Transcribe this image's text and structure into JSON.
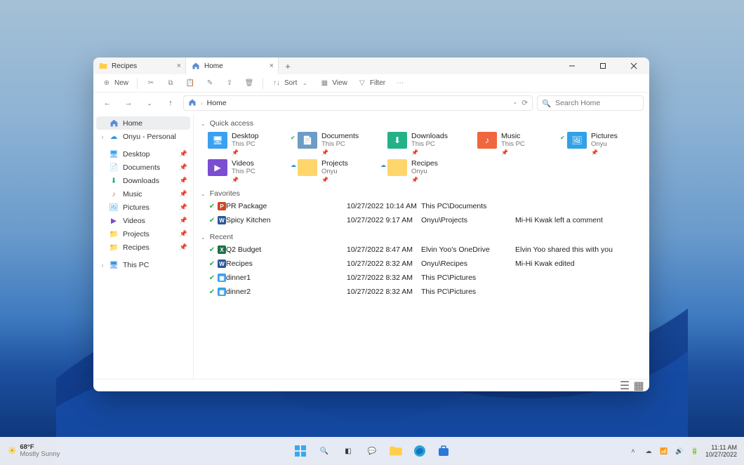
{
  "tabs": [
    {
      "label": "Recipes"
    },
    {
      "label": "Home"
    }
  ],
  "toolbar": {
    "new": "New",
    "sort": "Sort",
    "view": "View",
    "filter": "Filter"
  },
  "address": {
    "current": "Home"
  },
  "search": {
    "placeholder": "Search Home"
  },
  "sidebar": {
    "top": [
      {
        "label": "Home"
      },
      {
        "label": "Onyu - Personal"
      }
    ],
    "pinned": [
      {
        "label": "Desktop"
      },
      {
        "label": "Documents"
      },
      {
        "label": "Downloads"
      },
      {
        "label": "Music"
      },
      {
        "label": "Pictures"
      },
      {
        "label": "Videos"
      },
      {
        "label": "Projects"
      },
      {
        "label": "Recipes"
      }
    ],
    "bottom": [
      {
        "label": "This PC"
      }
    ]
  },
  "groups": {
    "quick_access": "Quick access",
    "favorites": "Favorites",
    "recent": "Recent"
  },
  "quick_access": [
    {
      "name": "Desktop",
      "loc": "This PC",
      "color": "#3aa0f0",
      "icon": "desktop"
    },
    {
      "name": "Documents",
      "loc": "This PC",
      "color": "#6d9cc4",
      "icon": "doc",
      "badge": true
    },
    {
      "name": "Downloads",
      "loc": "This PC",
      "color": "#23b188",
      "icon": "down"
    },
    {
      "name": "Music",
      "loc": "This PC",
      "color": "#f0663e",
      "icon": "music"
    },
    {
      "name": "Pictures",
      "loc": "Onyu",
      "color": "#2fa2e8",
      "icon": "pic",
      "badge": true
    },
    {
      "name": "Videos",
      "loc": "This PC",
      "color": "#7b4dd1",
      "icon": "video"
    },
    {
      "name": "Projects",
      "loc": "Onyu",
      "color": "#ffd66b",
      "icon": "folder",
      "cloud": true
    },
    {
      "name": "Recipes",
      "loc": "Onyu",
      "color": "#ffd66b",
      "icon": "folder",
      "cloud": true
    }
  ],
  "favorites": [
    {
      "name": "PR Package",
      "date": "10/27/2022 10:14 AM",
      "path": "This PC\\Documents",
      "note": "",
      "icon": "ppt"
    },
    {
      "name": "Spicy Kitchen",
      "date": "10/27/2022 9:17 AM",
      "path": "Onyu\\Projects",
      "note": "Mi-Hi Kwak left a comment",
      "icon": "word"
    }
  ],
  "recent": [
    {
      "name": "Q2 Budget",
      "date": "10/27/2022 8:47 AM",
      "path": "Elvin Yoo's OneDrive",
      "note": "Elvin Yoo shared this with you",
      "icon": "excel"
    },
    {
      "name": "Recipes",
      "date": "10/27/2022 8:32 AM",
      "path": "Onyu\\Recipes",
      "note": "Mi-Hi Kwak edited",
      "icon": "word"
    },
    {
      "name": "dinner1",
      "date": "10/27/2022 8:32 AM",
      "path": "This PC\\Pictures",
      "note": "",
      "icon": "image"
    },
    {
      "name": "dinner2",
      "date": "10/27/2022 8:32 AM",
      "path": "This PC\\Pictures",
      "note": "",
      "icon": "image"
    }
  ],
  "taskbar": {
    "temp": "68°F",
    "weather": "Mostly Sunny",
    "time": "11:11 AM",
    "date": "10/27/2022"
  }
}
